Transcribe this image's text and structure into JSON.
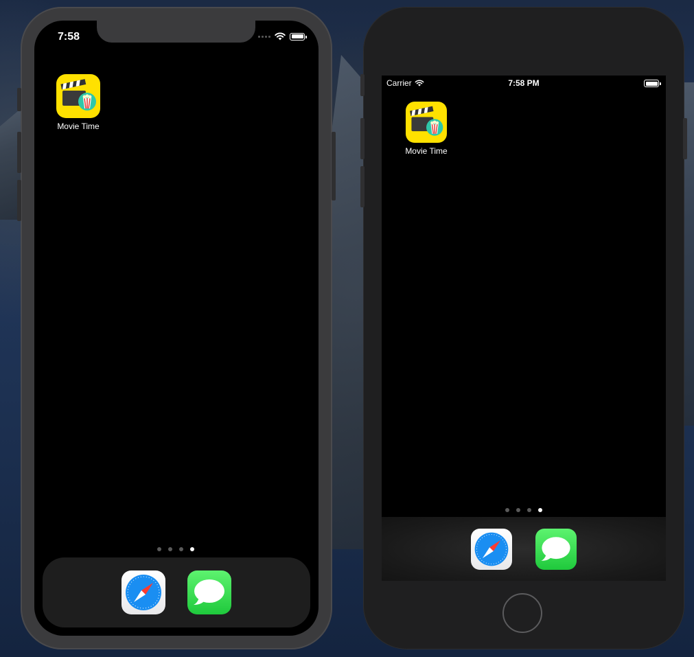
{
  "desktop": {
    "wallpaper": "dark-coastal-island"
  },
  "phone_x": {
    "status_bar": {
      "time": "7:58"
    },
    "home_apps": [
      {
        "label": "Movie Time",
        "icon": "clapperboard-popcorn-icon"
      }
    ],
    "page_indicator": {
      "pages": 4,
      "active_page": 4
    },
    "dock": [
      {
        "icon": "safari-icon"
      },
      {
        "icon": "messages-icon"
      }
    ]
  },
  "phone_8": {
    "status_bar": {
      "carrier": "Carrier",
      "time": "7:58 PM"
    },
    "home_apps": [
      {
        "label": "Movie Time",
        "icon": "clapperboard-popcorn-icon"
      }
    ],
    "page_indicator": {
      "pages": 4,
      "active_page": 4
    },
    "dock": [
      {
        "icon": "safari-icon"
      },
      {
        "icon": "messages-icon"
      }
    ]
  },
  "colors": {
    "app_icon_yellow": "#ffe100",
    "popcorn_teal": "#2fc7a9",
    "messages_green": "#1fc93c",
    "safari_blue": "#1a8ef2"
  }
}
